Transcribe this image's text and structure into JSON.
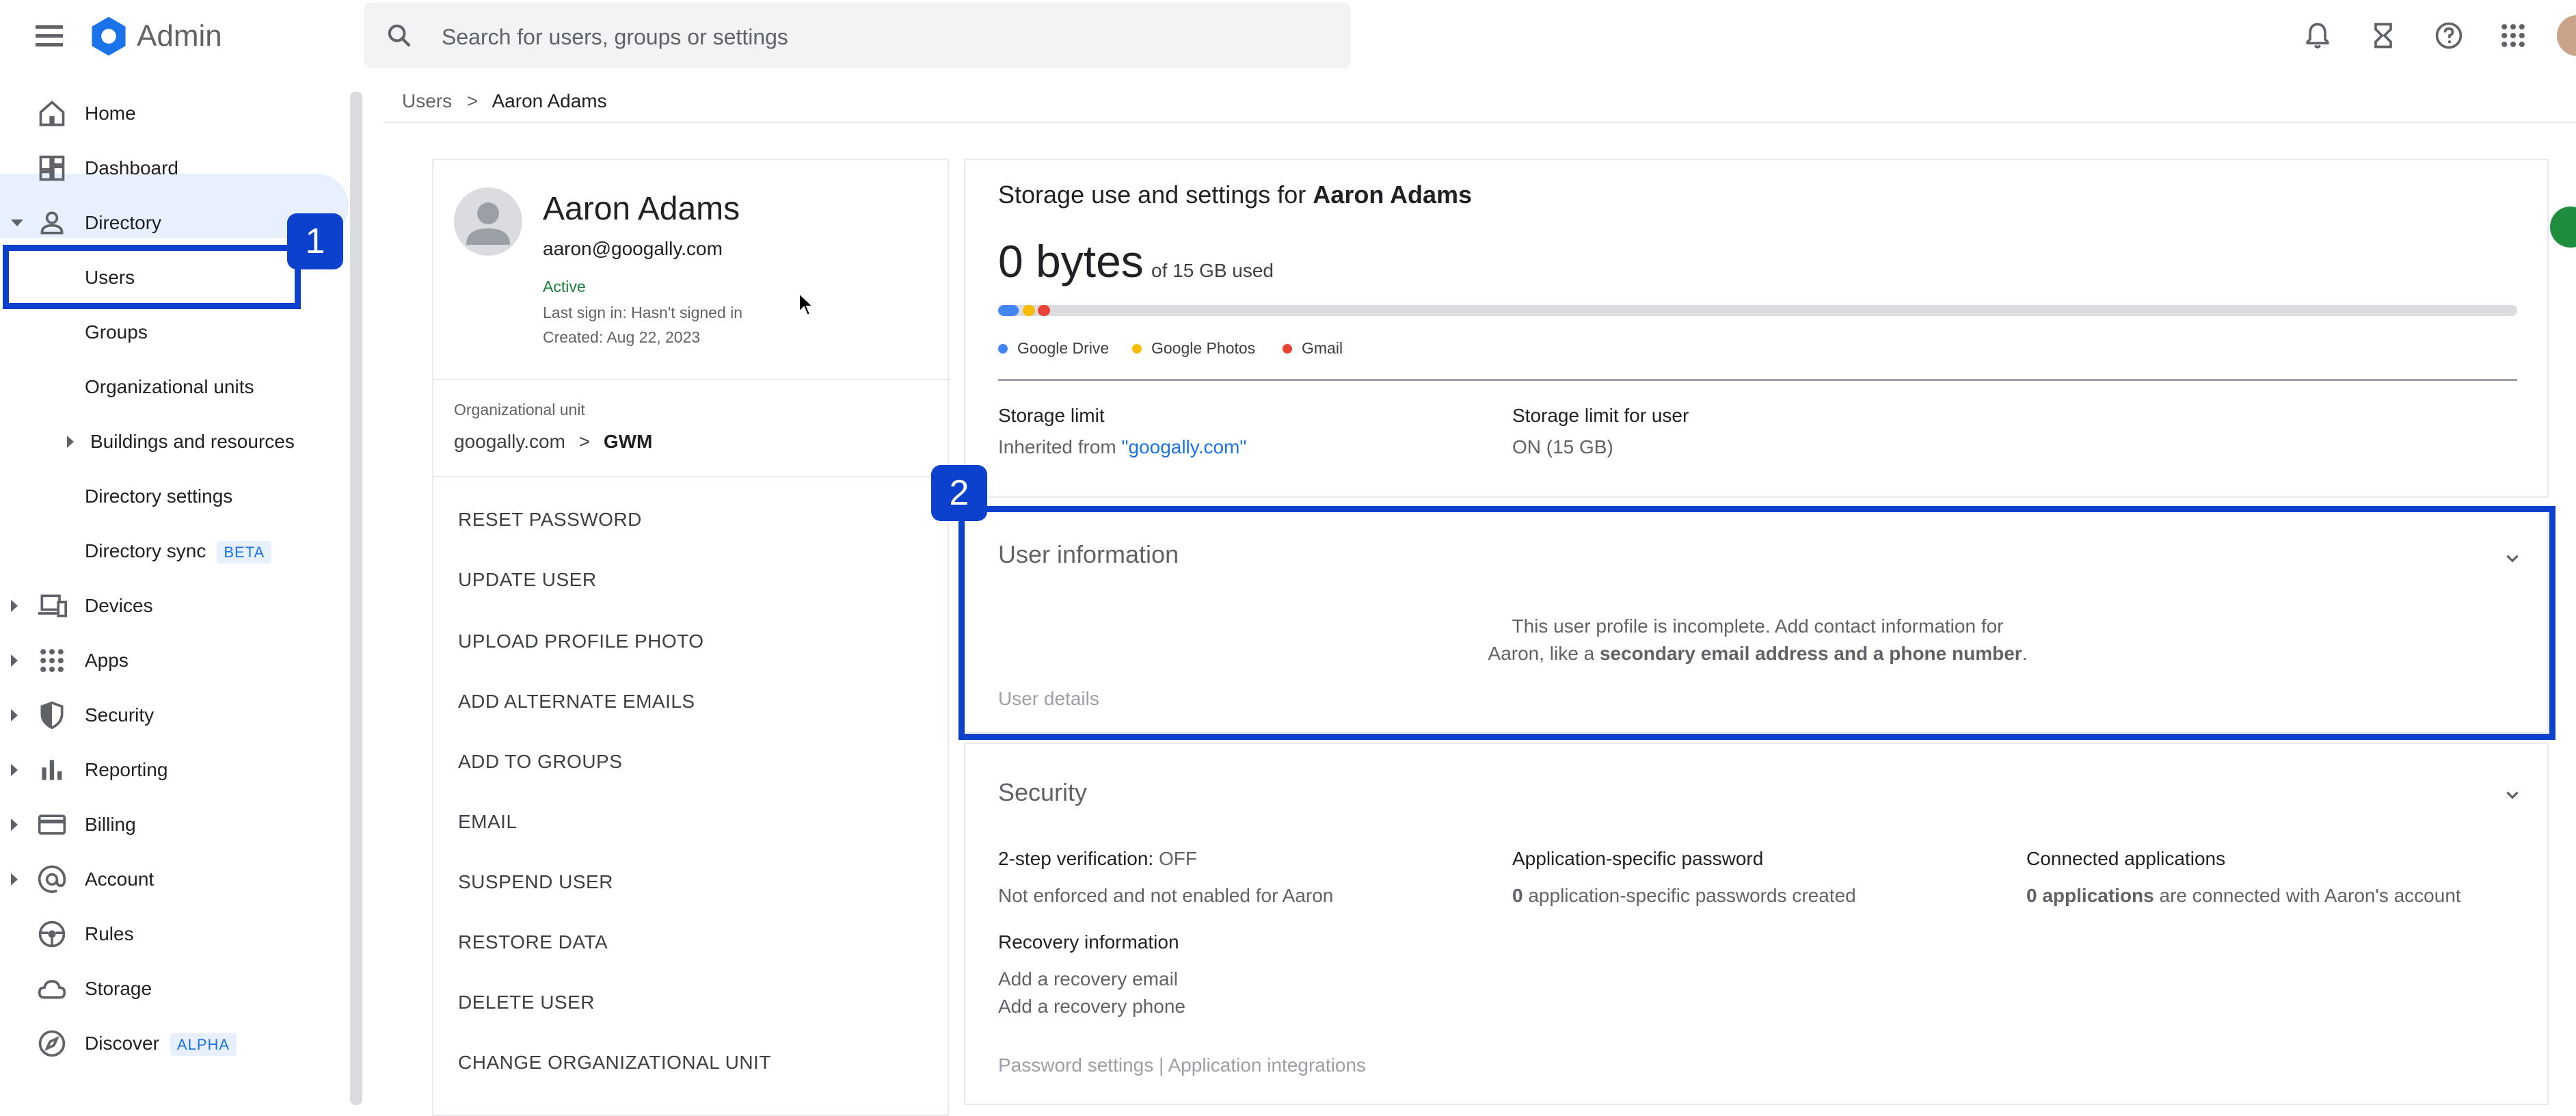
{
  "header": {
    "app_title": "Admin",
    "search_placeholder": "Search for users, groups or settings"
  },
  "sidebar": {
    "items": [
      {
        "label": "Home"
      },
      {
        "label": "Dashboard"
      },
      {
        "label": "Directory"
      },
      {
        "label": "Users"
      },
      {
        "label": "Groups"
      },
      {
        "label": "Organizational units"
      },
      {
        "label": "Buildings and resources"
      },
      {
        "label": "Directory settings"
      },
      {
        "label": "Directory sync",
        "badge": "BETA"
      },
      {
        "label": "Devices"
      },
      {
        "label": "Apps"
      },
      {
        "label": "Security"
      },
      {
        "label": "Reporting"
      },
      {
        "label": "Billing"
      },
      {
        "label": "Account"
      },
      {
        "label": "Rules"
      },
      {
        "label": "Storage"
      },
      {
        "label": "Discover",
        "badge": "ALPHA"
      }
    ]
  },
  "annotations": {
    "one": "1",
    "two": "2"
  },
  "breadcrumb": {
    "parent": "Users",
    "sep": ">",
    "current": "Aaron Adams"
  },
  "profile": {
    "name": "Aaron Adams",
    "email": "aaron@googally.com",
    "status": "Active",
    "last_sign_in": "Last sign in: Hasn't signed in",
    "created": "Created: Aug 22, 2023",
    "ou_label": "Organizational unit",
    "ou_parent": "googally.com",
    "ou_sep": ">",
    "ou_child": "GWM",
    "actions": [
      "RESET PASSWORD",
      "UPDATE USER",
      "UPLOAD PROFILE PHOTO",
      "ADD ALTERNATE EMAILS",
      "ADD TO GROUPS",
      "EMAIL",
      "SUSPEND USER",
      "RESTORE DATA",
      "DELETE USER",
      "CHANGE ORGANIZATIONAL UNIT"
    ]
  },
  "storage": {
    "title_prefix": "Storage use and settings for",
    "title_name": "Aaron Adams",
    "used": "0 bytes",
    "of_total": "of 15 GB used",
    "legend": [
      {
        "label": "Google Drive",
        "color": "#4285f4"
      },
      {
        "label": "Google Photos",
        "color": "#fbbc04"
      },
      {
        "label": "Gmail",
        "color": "#ea4335"
      }
    ],
    "limit_label": "Storage limit",
    "limit_value_prefix": "Inherited from ",
    "limit_value_link": "\"googally.com\"",
    "user_limit_label": "Storage limit for user",
    "user_limit_value": "ON (15 GB)"
  },
  "user_info": {
    "title": "User information",
    "message_line1": "This user profile is incomplete. Add contact information for",
    "message_line2_prefix": "Aaron, like a ",
    "message_line2_bold": "secondary email address and a phone number",
    "message_line2_suffix": ".",
    "details_link": "User details"
  },
  "security": {
    "title": "Security",
    "two_step_label": "2-step verification: ",
    "two_step_value": "OFF",
    "two_step_desc": "Not enforced and not enabled for Aaron",
    "app_pw_label": "Application-specific password",
    "app_pw_count": "0",
    "app_pw_desc": " application-specific passwords created",
    "connected_label": "Connected applications",
    "connected_count": "0 applications",
    "connected_desc": " are connected with Aaron's account",
    "recovery_label": "Recovery information",
    "recovery_email": "Add a recovery email",
    "recovery_phone": "Add a recovery phone",
    "footer_links": "Password settings | Application integrations"
  },
  "colors": {
    "accent": "#1a73e8",
    "highlight": "#0b41cd",
    "active": "#188038"
  }
}
